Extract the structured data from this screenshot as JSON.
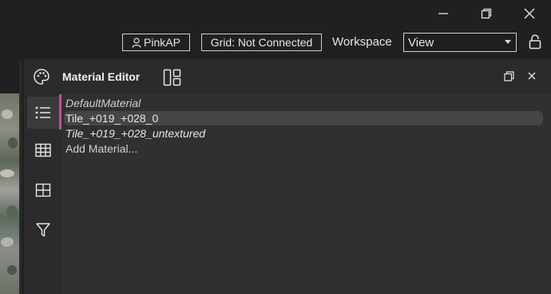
{
  "window": {
    "controls": [
      {
        "name": "minimize-button",
        "icon": "minimize-icon"
      },
      {
        "name": "restore-button",
        "icon": "restore-icon"
      },
      {
        "name": "close-button",
        "icon": "close-icon"
      }
    ]
  },
  "topbar": {
    "user_label": "PinkAP",
    "user_icon": "user-icon",
    "grid_status": "Grid: Not Connected",
    "workspace_label": "Workspace",
    "workspace_value": "View",
    "lock_icon": "lock-icon"
  },
  "panel": {
    "title": "Material Editor",
    "tab_icon": "palette-icon",
    "layout_icon": "layout-icon",
    "sidebar": [
      {
        "icon": "list-icon",
        "active": true
      },
      {
        "icon": "table-icon",
        "active": false
      },
      {
        "icon": "grid-icon",
        "active": false
      },
      {
        "icon": "filter-icon",
        "active": false
      }
    ],
    "materials": [
      {
        "label": "DefaultMaterial",
        "italic": true,
        "selected": false
      },
      {
        "label": "Tile_+019_+028_0",
        "italic": false,
        "selected": true
      },
      {
        "label": "Tile_+019_+028_untextured",
        "italic": true,
        "selected": false
      },
      {
        "label": "Add Material...",
        "italic": false,
        "selected": false
      }
    ]
  },
  "colors": {
    "background": "#202020",
    "panel": "#2b2b2b",
    "content": "#303030",
    "accent": "#d44a8c",
    "selection": "#454545"
  }
}
